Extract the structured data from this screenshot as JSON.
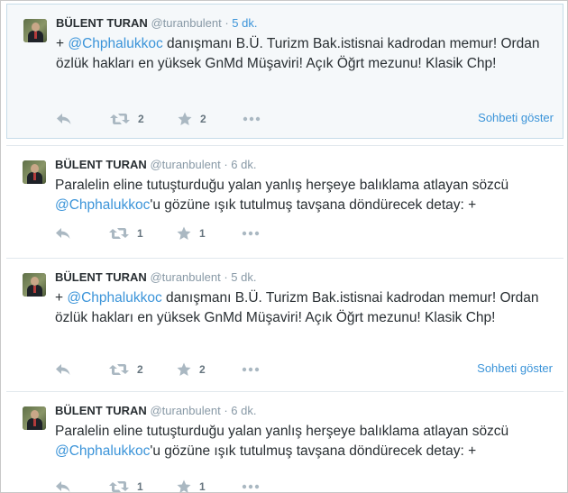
{
  "tweets": [
    {
      "name": "BÜLENT TURAN",
      "handle": "@turanbulent",
      "sep": "·",
      "time": "5 dk.",
      "text_pre": "+ ",
      "mention": "@Chphalukkoc",
      "text_post": " danışmanı B.Ü. Turizm Bak.istisnai kadrodan memur! Ordan özlük hakları en yüksek GnMd Müşaviri! Açık Öğrt mezunu! Klasik Chp!",
      "retweets": "2",
      "favorites": "2",
      "conversation": "Sohbeti göster"
    },
    {
      "name": "BÜLENT TURAN",
      "handle": "@turanbulent",
      "sep": "·",
      "time": "6 dk.",
      "text_pre": "Paralelin eline tutuşturduğu yalan yanlış herşeye balıklama atlayan sözcü ",
      "mention": "@Chphalukkoc",
      "text_post": "'u gözüne ışık tutulmuş tavşana döndürecek detay: +",
      "retweets": "1",
      "favorites": "1"
    },
    {
      "name": "BÜLENT TURAN",
      "handle": "@turanbulent",
      "sep": "·",
      "time": "5 dk.",
      "text_pre": "+ ",
      "mention": "@Chphalukkoc",
      "text_post": " danışmanı B.Ü. Turizm Bak.istisnai kadrodan memur! Ordan özlük hakları en yüksek GnMd Müşaviri! Açık Öğrt mezunu! Klasik Chp!",
      "retweets": "2",
      "favorites": "2",
      "conversation": "Sohbeti göster"
    },
    {
      "name": "BÜLENT TURAN",
      "handle": "@turanbulent",
      "sep": "·",
      "time": "6 dk.",
      "text_pre": "Paralelin eline tutuşturduğu yalan yanlış herşeye balıklama atlayan sözcü ",
      "mention": "@Chphalukkoc",
      "text_post": "'u gözüne ışık tutulmuş tavşana döndürecek detay: +",
      "retweets": "1",
      "favorites": "1"
    }
  ],
  "icons": {
    "reply": "reply-icon",
    "retweet": "retweet-icon",
    "favorite": "star-icon",
    "more": "more-icon"
  },
  "colors": {
    "link": "#3b94d9",
    "muted": "#8899a6",
    "text": "#292f33",
    "highlight_bg": "#f5f8fa"
  }
}
